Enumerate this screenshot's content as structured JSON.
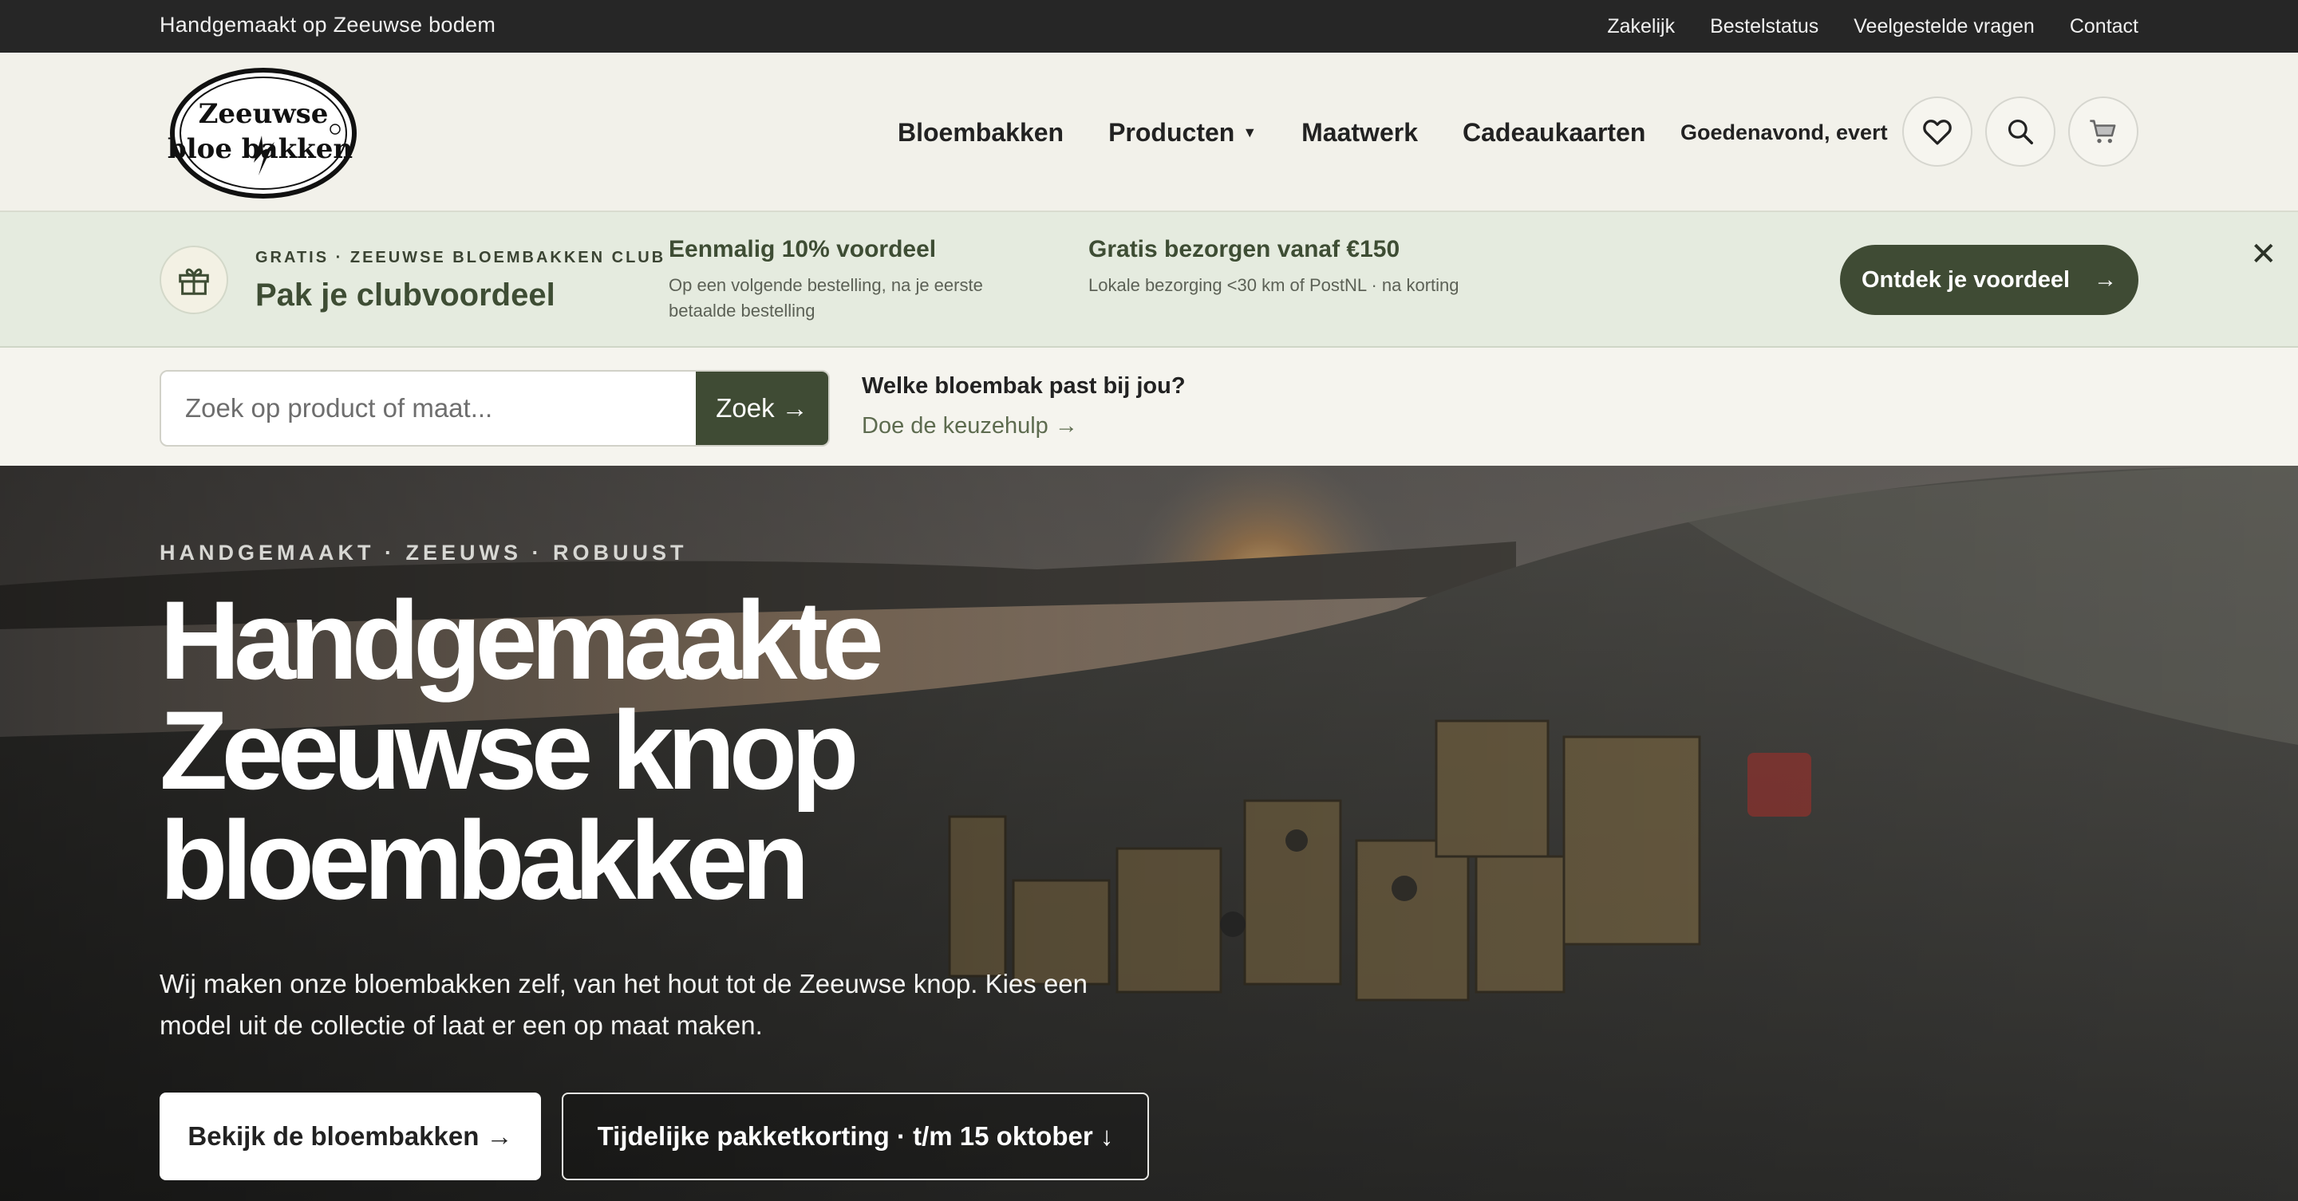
{
  "topbar": {
    "tagline": "Handgemaakt op Zeeuwse bodem",
    "links": [
      "Zakelijk",
      "Bestelstatus",
      "Veelgestelde vragen",
      "Contact"
    ]
  },
  "header": {
    "logo_alt": "Zeeuwse bloembakken",
    "nav": [
      "Bloembakken",
      "Producten",
      "Maatwerk",
      "Cadeaukaarten"
    ],
    "greeting": "Goedenavond, evert",
    "icons": [
      "heart-icon",
      "search-icon",
      "cart-icon"
    ]
  },
  "club": {
    "kicker": "GRATIS · ZEEUWSE BLOEMBAKKEN CLUB",
    "title": "Pak je clubvoordeel",
    "benefits": [
      {
        "title": "Eenmalig 10% voordeel",
        "desc": "Op een volgende bestelling, na je eerste betaalde bestelling"
      },
      {
        "title": "Gratis bezorgen vanaf €150",
        "desc": "Lokale bezorging <30 km of PostNL · na korting"
      }
    ],
    "cta": "Ontdek je voordeel",
    "cta_arrow": "→",
    "close": "✕"
  },
  "search": {
    "placeholder": "Zoek op product of maat...",
    "button": "Zoek →",
    "help_question": "Welke bloembak past bij jou?",
    "help_link": "Doe de keuzehulp →"
  },
  "hero": {
    "kicker": "HANDGEMAAKT · ZEEUWS · ROBUUST",
    "title_lines": [
      "Handgemaakte",
      "Zeeuwse knop",
      "bloembakken"
    ],
    "text": "Wij maken onze bloembakken zelf, van het hout tot de Zeeuwse knop. Kies een model uit de collectie of laat er een op maat maken.",
    "primary_button": "Bekijk de bloembakken →",
    "secondary_button": "Tijdelijke pakketkorting · t/m 15 oktober ↓"
  },
  "colors": {
    "topbar": "#262626",
    "accent": "#3f4b34",
    "club_bg": "#e5ebdf",
    "page_bg": "#f2f1ea"
  }
}
